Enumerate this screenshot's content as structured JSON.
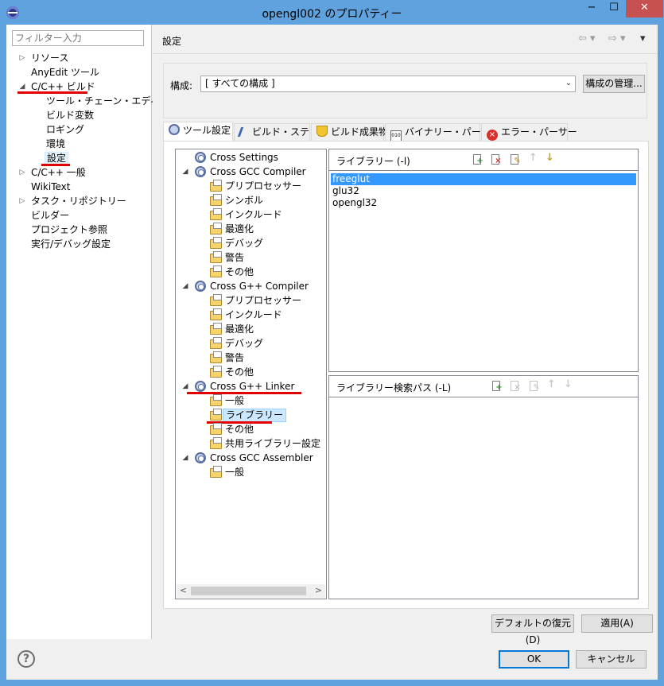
{
  "window": {
    "title": "opengl002 のプロパティー",
    "min_glyph": "−",
    "max_glyph": "☐",
    "close_glyph": "✕"
  },
  "nav": {
    "filter_placeholder": "フィルター入力",
    "items": [
      {
        "label": "リソース",
        "expander": "▷"
      },
      {
        "label": "AnyEdit ツール",
        "expander": ""
      },
      {
        "label": "C/C++ ビルド",
        "expander": "◢"
      },
      {
        "label": "ツール・チェーン・エディター",
        "expander": ""
      },
      {
        "label": "ビルド変数",
        "expander": ""
      },
      {
        "label": "ロギング",
        "expander": ""
      },
      {
        "label": "環境",
        "expander": ""
      },
      {
        "label": "設定",
        "expander": ""
      },
      {
        "label": "C/C++ 一般",
        "expander": "▷"
      },
      {
        "label": "WikiText",
        "expander": ""
      },
      {
        "label": "タスク・リポジトリー",
        "expander": "▷"
      },
      {
        "label": "ビルダー",
        "expander": ""
      },
      {
        "label": "プロジェクト参照",
        "expander": ""
      },
      {
        "label": "実行/デバッグ設定",
        "expander": ""
      }
    ]
  },
  "page": {
    "title": "設定",
    "back_glyph": "⇦ ▾",
    "forward_glyph": "⇨ ▾",
    "menu_glyph": "▾",
    "config_label": "構成:",
    "config_value": "[ すべての構成 ]",
    "config_arrow": "⌄",
    "manage_button": "構成の管理..."
  },
  "tabs": [
    {
      "label": "ツール設定"
    },
    {
      "label": "ビルド・ステップ"
    },
    {
      "label": "ビルド成果物"
    },
    {
      "label": "バイナリー・パーサー"
    },
    {
      "label": "エラー・パーサー"
    }
  ],
  "tool_tree": [
    {
      "label": "Cross Settings",
      "kind": "tool"
    },
    {
      "label": "Cross GCC Compiler",
      "kind": "tool"
    },
    {
      "label": "プリプロセッサー",
      "kind": "option"
    },
    {
      "label": "シンボル",
      "kind": "option"
    },
    {
      "label": "インクルード",
      "kind": "option"
    },
    {
      "label": "最適化",
      "kind": "option"
    },
    {
      "label": "デバッグ",
      "kind": "option"
    },
    {
      "label": "警告",
      "kind": "option"
    },
    {
      "label": "その他",
      "kind": "option"
    },
    {
      "label": "Cross G++ Compiler",
      "kind": "tool"
    },
    {
      "label": "プリプロセッサー",
      "kind": "option"
    },
    {
      "label": "インクルード",
      "kind": "option"
    },
    {
      "label": "最適化",
      "kind": "option"
    },
    {
      "label": "デバッグ",
      "kind": "option"
    },
    {
      "label": "警告",
      "kind": "option"
    },
    {
      "label": "その他",
      "kind": "option"
    },
    {
      "label": "Cross G++ Linker",
      "kind": "tool"
    },
    {
      "label": "一般",
      "kind": "option"
    },
    {
      "label": "ライブラリー",
      "kind": "option"
    },
    {
      "label": "その他",
      "kind": "option"
    },
    {
      "label": "共用ライブラリー設定",
      "kind": "option"
    },
    {
      "label": "Cross GCC Assembler",
      "kind": "tool"
    },
    {
      "label": "一般",
      "kind": "option"
    }
  ],
  "tree_expander": "◢",
  "scroll": {
    "left": "<",
    "right": ">"
  },
  "libraries": {
    "label": "ライブラリー (-l)",
    "items": [
      "freeglut",
      "glu32",
      "opengl32"
    ]
  },
  "library_paths": {
    "label": "ライブラリー検索パス (-L)",
    "items": []
  },
  "toolbar_marks": {
    "add": "+",
    "delete": "×",
    "edit": "✎",
    "up": "↑",
    "down": "↓"
  },
  "buttons": {
    "restore_defaults": "デフォルトの復元(D)",
    "apply": "適用(A)",
    "ok": "OK",
    "cancel": "キャンセル",
    "help": "?"
  },
  "colors": {
    "titlebar": "#5fa2dd",
    "selection": "#3399ff",
    "annotation_underline": "#e00000"
  }
}
